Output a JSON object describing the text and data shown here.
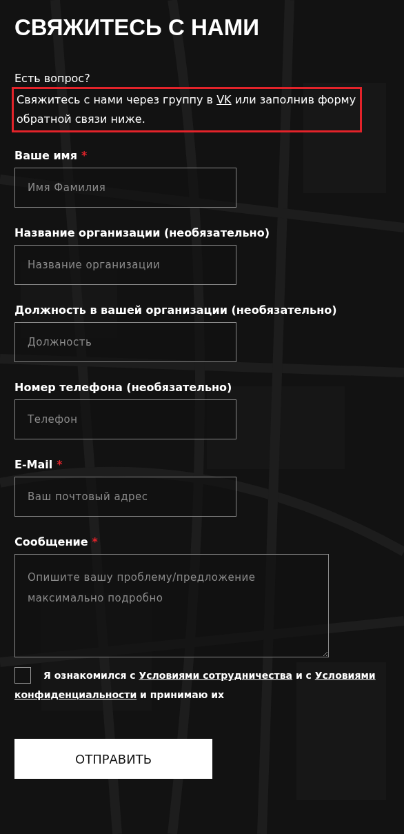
{
  "title": "СВЯЖИТЕСЬ С НАМИ",
  "intro": {
    "question": "Есть вопрос?",
    "highlighted": true,
    "before": "Свяжитесь с нами через группу в ",
    "link": "VK",
    "after": " или заполнив форму обратной связи ниже."
  },
  "fields": [
    {
      "kind": "input",
      "label": "Ваше имя",
      "required_mark": "*",
      "placeholder": "Имя Фамилия"
    },
    {
      "kind": "input",
      "label": "Название организации (необязательно)",
      "placeholder": "Название организации"
    },
    {
      "kind": "input",
      "label": "Должность в вашей организации (необязательно)",
      "placeholder": "Должность"
    },
    {
      "kind": "input",
      "label": "Номер телефона (необязательно)",
      "placeholder": "Телефон"
    },
    {
      "kind": "input",
      "label": "E-Mail",
      "required_mark": "*",
      "placeholder": "Ваш почтовый адрес"
    },
    {
      "kind": "textarea",
      "label": "Сообщение",
      "required_mark": "*",
      "placeholder": "Опишите вашу проблему/предложение максимально подробно"
    }
  ],
  "consent": {
    "checked": false,
    "lines": [
      [
        {
          "kind": "text",
          "text": "Я ознакомился с "
        },
        {
          "kind": "link",
          "text": "Условиями сотрудничества"
        },
        {
          "kind": "text",
          "text": " и с "
        },
        {
          "kind": "link",
          "text": "Условиями"
        }
      ],
      [
        {
          "kind": "link",
          "text": "конфиденциальности"
        },
        {
          "kind": "text",
          "text": " и принимаю их"
        }
      ]
    ]
  },
  "submit": "ОТПРАВИТЬ"
}
